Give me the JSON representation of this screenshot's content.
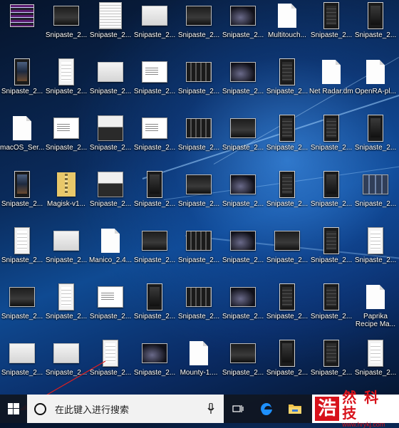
{
  "desktop": {
    "rows": [
      [
        {
          "label": "",
          "thumb": "glitch"
        },
        {
          "label": "Snipaste_2...",
          "thumb": "wide dark"
        },
        {
          "label": "Snipaste_2...",
          "thumb": "sheet"
        },
        {
          "label": "Snipaste_2...",
          "thumb": "wide light"
        },
        {
          "label": "Snipaste_2...",
          "thumb": "wide dark"
        },
        {
          "label": "Snipaste_2...",
          "thumb": "wide space"
        },
        {
          "label": "Multitouch...",
          "thumb": "doc"
        },
        {
          "label": "Snipaste_2...",
          "thumb": "phone list"
        },
        {
          "label": "Snipaste_2...",
          "thumb": "phone"
        }
      ],
      [
        {
          "label": "Snipaste_2...",
          "thumb": "phone colorful"
        },
        {
          "label": "Snipaste_2...",
          "thumb": "phone white"
        },
        {
          "label": "Snipaste_2...",
          "thumb": "wide light"
        },
        {
          "label": "Snipaste_2...",
          "thumb": "menu"
        },
        {
          "label": "Snipaste_2...",
          "thumb": "wide cols"
        },
        {
          "label": "Snipaste_2...",
          "thumb": "wide space"
        },
        {
          "label": "Snipaste_2...",
          "thumb": "phone list"
        },
        {
          "label": "Net Radar.dmg",
          "thumb": "doc"
        },
        {
          "label": "OpenRA-pl...",
          "thumb": "doc"
        }
      ],
      [
        {
          "label": "macOS_Ser...",
          "thumb": "doc"
        },
        {
          "label": "Snipaste_2...",
          "thumb": "menu"
        },
        {
          "label": "Snipaste_2...",
          "thumb": "mixed"
        },
        {
          "label": "Snipaste_2...",
          "thumb": "menu"
        },
        {
          "label": "Snipaste_2...",
          "thumb": "wide cols"
        },
        {
          "label": "Snipaste_2...",
          "thumb": "wide dark"
        },
        {
          "label": "Snipaste_2...",
          "thumb": "phone list"
        },
        {
          "label": "Snipaste_2...",
          "thumb": "phone list"
        },
        {
          "label": "Snipaste_2...",
          "thumb": "phone"
        }
      ],
      [
        {
          "label": "Snipaste_2...",
          "thumb": "phone colorful"
        },
        {
          "label": "Magisk-v1...",
          "thumb": "zip"
        },
        {
          "label": "Snipaste_2...",
          "thumb": "mixed"
        },
        {
          "label": "Snipaste_2...",
          "thumb": "phone"
        },
        {
          "label": "Snipaste_2...",
          "thumb": "wide dark"
        },
        {
          "label": "Snipaste_2...",
          "thumb": "wide space"
        },
        {
          "label": "Snipaste_2...",
          "thumb": "phone list"
        },
        {
          "label": "Snipaste_2...",
          "thumb": "phone"
        },
        {
          "label": "Snipaste_2...",
          "thumb": "tile"
        }
      ],
      [
        {
          "label": "Snipaste_2...",
          "thumb": "phone white"
        },
        {
          "label": "Snipaste_2...",
          "thumb": "wide light"
        },
        {
          "label": "Manico_2.4...",
          "thumb": "doc"
        },
        {
          "label": "Snipaste_2...",
          "thumb": "wide dark"
        },
        {
          "label": "Snipaste_2...",
          "thumb": "wide cols"
        },
        {
          "label": "Snipaste_2...",
          "thumb": "wide space"
        },
        {
          "label": "Snipaste_2...",
          "thumb": "wide dark"
        },
        {
          "label": "Snipaste_2...",
          "thumb": "phone list"
        },
        {
          "label": "Snipaste_2...",
          "thumb": "phone white"
        }
      ],
      [
        {
          "label": "Snipaste_2...",
          "thumb": "wide dark"
        },
        {
          "label": "Snipaste_2...",
          "thumb": "phone white"
        },
        {
          "label": "Snipaste_2...",
          "thumb": "menu"
        },
        {
          "label": "Snipaste_2...",
          "thumb": "phone"
        },
        {
          "label": "Snipaste_2...",
          "thumb": "wide cols"
        },
        {
          "label": "Snipaste_2...",
          "thumb": "wide space"
        },
        {
          "label": "Snipaste_2...",
          "thumb": "phone list"
        },
        {
          "label": "Snipaste_2...",
          "thumb": "phone list"
        },
        {
          "label": "Paprika Recipe Ma...",
          "thumb": "doc"
        }
      ],
      [
        {
          "label": "Snipaste_2...",
          "thumb": "wide light"
        },
        {
          "label": "Snipaste_2...",
          "thumb": "wide light"
        },
        {
          "label": "Snipaste_2...",
          "thumb": "phone white"
        },
        {
          "label": "Snipaste_2...",
          "thumb": "wide space"
        },
        {
          "label": "Mounty-1....",
          "thumb": "doc"
        },
        {
          "label": "Snipaste_2...",
          "thumb": "wide dark"
        },
        {
          "label": "Snipaste_2...",
          "thumb": "phone"
        },
        {
          "label": "Snipaste_2...",
          "thumb": "phone list"
        },
        {
          "label": "Snipaste_2...",
          "thumb": "phone white"
        }
      ]
    ]
  },
  "taskbar": {
    "search_placeholder": "在此键入进行搜索",
    "icons": {
      "start": "windows-logo-icon",
      "search": "cortana-circle-icon",
      "mic": "microphone-icon",
      "taskview": "task-view-icon",
      "edge": "edge-browser-icon",
      "explorer": "file-explorer-icon"
    },
    "accent_color": "#1e90ff"
  },
  "watermark": {
    "logo_char": "浩",
    "title": "然 科 技",
    "url": "www.hrykj.com",
    "color": "#d8121b"
  }
}
